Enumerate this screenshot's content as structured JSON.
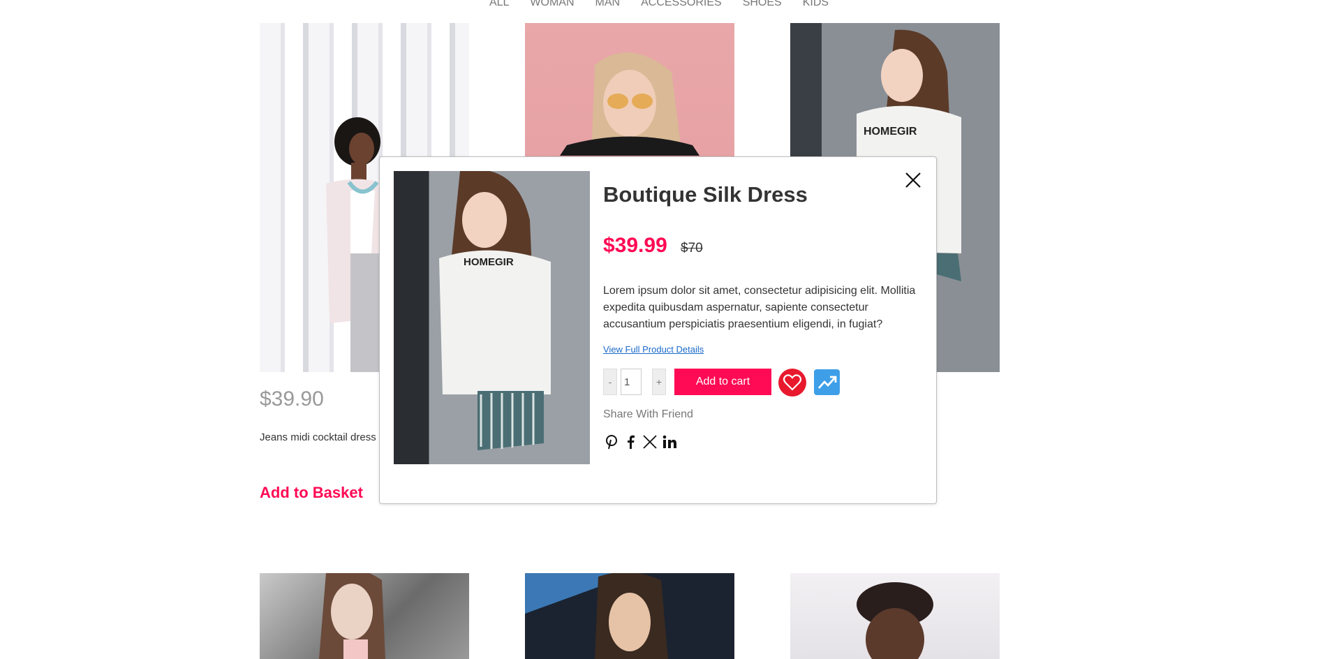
{
  "nav": {
    "items": [
      "ALL",
      "WOMAN",
      "MAN",
      "ACCESSORIES",
      "SHOES",
      "KIDS"
    ]
  },
  "product_card": {
    "price": "$39.90",
    "name": "Jeans midi cocktail dress",
    "basket_label": "Add to Basket"
  },
  "modal": {
    "title": "Boutique Silk Dress",
    "price_new": "$39.99",
    "price_old": "$70",
    "description": "Lorem ipsum dolor sit amet, consectetur adipisicing elit. Mollitia expedita quibusdam aspernatur, sapiente consectetur accusantium perspiciatis praesentium eligendi, in fugiat?",
    "details_link": "View Full Product Details",
    "qty_minus": "-",
    "qty_plus": "+",
    "qty_value": "1",
    "add_to_cart": "Add to cart",
    "share_label": "Share With Friend",
    "icons": {
      "close": "close-icon",
      "favorite": "heart-icon",
      "compare": "trending-up-icon",
      "social": [
        "pinterest-icon",
        "facebook-icon",
        "x-icon",
        "linkedin-icon"
      ]
    }
  },
  "colors": {
    "accent": "#ff0a54",
    "link": "#1b6ac9",
    "favorite": "#e8192c",
    "compare": "#3e9fe8",
    "muted_price": "#999999"
  }
}
